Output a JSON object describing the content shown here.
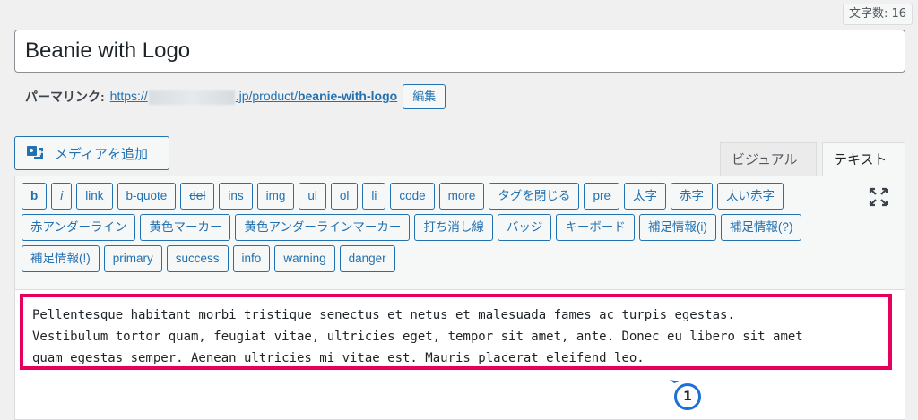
{
  "char_count": "文字数: 16",
  "title": "Beanie with Logo",
  "permalink": {
    "label": "パーマリンク:",
    "url_prefix": "https://",
    "url_domain_suffix": ".jp/product/",
    "slug": "beanie-with-logo",
    "edit_label": "編集"
  },
  "media_button": {
    "label": "メディアを追加",
    "icon": "media-icon"
  },
  "tabs": {
    "visual": "ビジュアル",
    "text": "テキスト"
  },
  "toolbar": {
    "buttons": [
      "b",
      "i",
      "link",
      "b-quote",
      "del",
      "ins",
      "img",
      "ul",
      "ol",
      "li",
      "code",
      "more",
      "タグを閉じる",
      "pre",
      "太字",
      "赤字",
      "太い赤字",
      "赤アンダーライン",
      "黄色マーカー",
      "黄色アンダーラインマーカー",
      "打ち消し線",
      "バッジ",
      "キーボード",
      "補足情報(i)",
      "補足情報(?)",
      "補足情報(!)",
      "primary",
      "success",
      "info",
      "warning",
      "danger"
    ],
    "fullscreen_icon": "fullscreen-icon"
  },
  "content": "Pellentesque habitant morbi tristique senectus et netus et malesuada fames ac turpis egestas.\nVestibulum tortor quam, feugiat vitae, ultricies eget, tempor sit amet, ante. Donec eu libero sit amet\nquam egestas semper. Aenean ultricies mi vitae est. Mauris placerat eleifend leo.",
  "marker": {
    "number": "1",
    "color": "#1e6fd9"
  },
  "colors": {
    "accent": "#2271b1",
    "highlight": "#e6005c"
  }
}
